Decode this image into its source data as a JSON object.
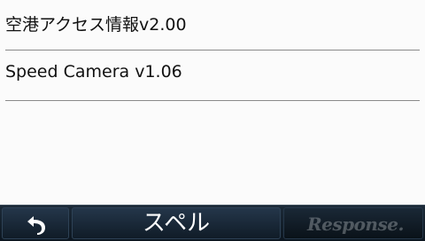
{
  "list": {
    "items": [
      {
        "label": "空港アクセス情報v2.00"
      },
      {
        "label": "Speed Camera v1.06"
      }
    ]
  },
  "toolbar": {
    "back_icon": "back-arrow-icon",
    "spell_label": "スペル",
    "watermark": "Response."
  },
  "colors": {
    "background": "#fbfbfb",
    "toolbar": "#101c28",
    "divider": "#8a8a8a"
  }
}
